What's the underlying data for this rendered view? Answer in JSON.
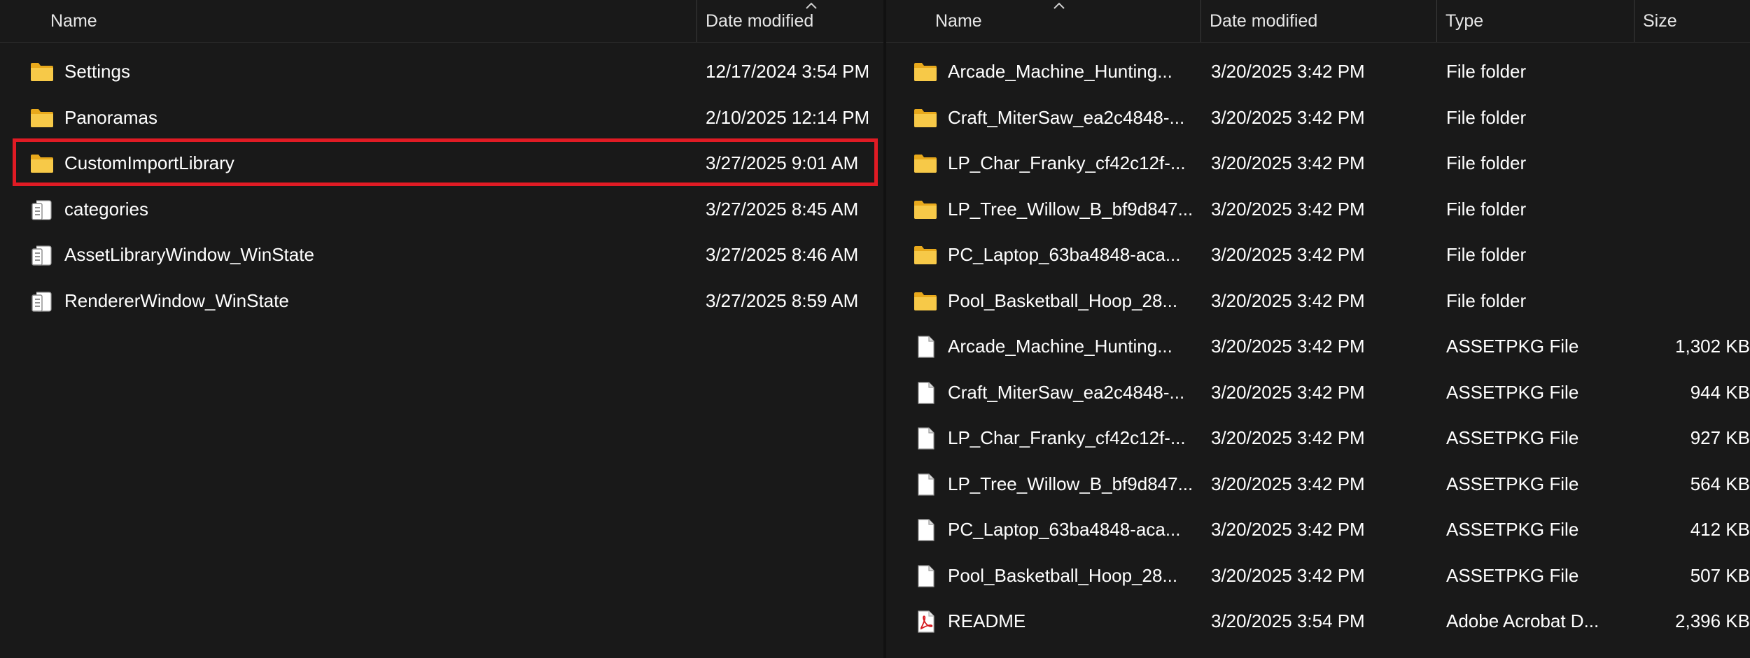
{
  "left_pane": {
    "columns": {
      "name": "Name",
      "date_modified": "Date modified"
    },
    "rows": [
      {
        "icon": "folder-icon",
        "name": "Settings",
        "date": "12/17/2024 3:54 PM"
      },
      {
        "icon": "folder-icon",
        "name": "Panoramas",
        "date": "2/10/2025 12:14 PM"
      },
      {
        "icon": "folder-icon",
        "name": "CustomImportLibrary",
        "date": "3/27/2025 9:01 AM",
        "highlighted": true
      },
      {
        "icon": "config-file-icon",
        "name": "categories",
        "date": "3/27/2025 8:45 AM"
      },
      {
        "icon": "config-file-icon",
        "name": "AssetLibraryWindow_WinState",
        "date": "3/27/2025 8:46 AM"
      },
      {
        "icon": "config-file-icon",
        "name": "RendererWindow_WinState",
        "date": "3/27/2025 8:59 AM"
      }
    ]
  },
  "right_pane": {
    "columns": {
      "name": "Name",
      "date_modified": "Date modified",
      "type": "Type",
      "size": "Size"
    },
    "rows": [
      {
        "icon": "folder-icon",
        "name": "Arcade_Machine_Hunting...",
        "date": "3/20/2025 3:42 PM",
        "type": "File folder",
        "size": ""
      },
      {
        "icon": "folder-icon",
        "name": "Craft_MiterSaw_ea2c4848-...",
        "date": "3/20/2025 3:42 PM",
        "type": "File folder",
        "size": ""
      },
      {
        "icon": "folder-icon",
        "name": "LP_Char_Franky_cf42c12f-...",
        "date": "3/20/2025 3:42 PM",
        "type": "File folder",
        "size": ""
      },
      {
        "icon": "folder-icon",
        "name": "LP_Tree_Willow_B_bf9d847...",
        "date": "3/20/2025 3:42 PM",
        "type": "File folder",
        "size": ""
      },
      {
        "icon": "folder-icon",
        "name": "PC_Laptop_63ba4848-aca...",
        "date": "3/20/2025 3:42 PM",
        "type": "File folder",
        "size": ""
      },
      {
        "icon": "folder-icon",
        "name": "Pool_Basketball_Hoop_28...",
        "date": "3/20/2025 3:42 PM",
        "type": "File folder",
        "size": ""
      },
      {
        "icon": "file-icon",
        "name": "Arcade_Machine_Hunting...",
        "date": "3/20/2025 3:42 PM",
        "type": "ASSETPKG File",
        "size": "1,302 KB"
      },
      {
        "icon": "file-icon",
        "name": "Craft_MiterSaw_ea2c4848-...",
        "date": "3/20/2025 3:42 PM",
        "type": "ASSETPKG File",
        "size": "944 KB"
      },
      {
        "icon": "file-icon",
        "name": "LP_Char_Franky_cf42c12f-...",
        "date": "3/20/2025 3:42 PM",
        "type": "ASSETPKG File",
        "size": "927 KB"
      },
      {
        "icon": "file-icon",
        "name": "LP_Tree_Willow_B_bf9d847...",
        "date": "3/20/2025 3:42 PM",
        "type": "ASSETPKG File",
        "size": "564 KB"
      },
      {
        "icon": "file-icon",
        "name": "PC_Laptop_63ba4848-aca...",
        "date": "3/20/2025 3:42 PM",
        "type": "ASSETPKG File",
        "size": "412 KB"
      },
      {
        "icon": "file-icon",
        "name": "Pool_Basketball_Hoop_28...",
        "date": "3/20/2025 3:42 PM",
        "type": "ASSETPKG File",
        "size": "507 KB"
      },
      {
        "icon": "pdf-icon",
        "name": "README",
        "date": "3/20/2025 3:54 PM",
        "type": "Adobe Acrobat D...",
        "size": "2,396 KB"
      }
    ]
  },
  "colors": {
    "background": "#191919",
    "highlight_border": "#e01b24",
    "folder": "#f4c542",
    "header_text": "#e6e6e6"
  }
}
